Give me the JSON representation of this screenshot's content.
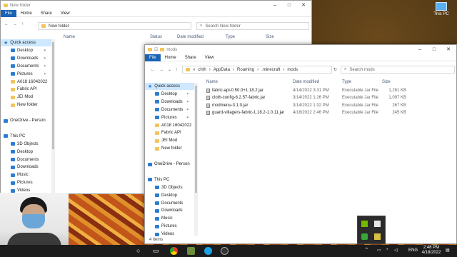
{
  "desktop": {
    "this_pc_label": "This PC"
  },
  "bg_window": {
    "title": "New folder",
    "tabs": [
      "File",
      "Home",
      "Share",
      "View"
    ],
    "path": "New folder",
    "search_placeholder": "Search New folder",
    "columns": [
      "Name",
      "Status",
      "Date modified",
      "Type",
      "Size"
    ],
    "sidebar": [
      {
        "label": "Quick access",
        "icon": "star",
        "sel": true
      },
      {
        "label": "Desktop",
        "icon": "blue",
        "pin": true
      },
      {
        "label": "Downloads",
        "icon": "blue",
        "pin": true
      },
      {
        "label": "Documents",
        "icon": "blue",
        "pin": true
      },
      {
        "label": "Pictures",
        "icon": "blue",
        "pin": true
      },
      {
        "label": "A018 16042022",
        "icon": "fold"
      },
      {
        "label": "Fabric API",
        "icon": "fold"
      },
      {
        "label": "JEI Mod",
        "icon": "fold"
      },
      {
        "label": "New folder",
        "icon": "fold"
      },
      {
        "label": "",
        "icon": ""
      },
      {
        "label": "OneDrive - Person",
        "icon": "blue"
      },
      {
        "label": "",
        "icon": ""
      },
      {
        "label": "This PC",
        "icon": "blue"
      },
      {
        "label": "3D Objects",
        "icon": "blue"
      },
      {
        "label": "Desktop",
        "icon": "blue"
      },
      {
        "label": "Documents",
        "icon": "blue"
      },
      {
        "label": "Downloads",
        "icon": "blue"
      },
      {
        "label": "Music",
        "icon": "blue"
      },
      {
        "label": "Pictures",
        "icon": "blue"
      },
      {
        "label": "Videos",
        "icon": "blue"
      }
    ]
  },
  "fg_window": {
    "title": "mods",
    "tabs": [
      "File",
      "Home",
      "Share",
      "View"
    ],
    "path": [
      "chth",
      "AppData",
      "Roaming",
      ".minecraft",
      "mods"
    ],
    "search_placeholder": "Search mods",
    "columns": [
      "Name",
      "Date modified",
      "Type",
      "Size"
    ],
    "files": [
      {
        "name": "fabric-api-0.50.0+1.18.2.jar",
        "date": "4/14/2022 3:31 PM",
        "type": "Executable Jar File",
        "size": "1,281 KB"
      },
      {
        "name": "cloth-config-6.2.57-fabric.jar",
        "date": "3/14/2022 1:26 PM",
        "type": "Executable Jar File",
        "size": "1,097 KB"
      },
      {
        "name": "modmenu-3.1.0.jar",
        "date": "3/14/2022 1:32 PM",
        "type": "Executable Jar File",
        "size": "267 KB"
      },
      {
        "name": "guard-villagers-fabric-1.18.2-1.0.11.jar",
        "date": "4/18/2022 2:46 PM",
        "type": "Executable Jar File",
        "size": "245 KB"
      }
    ],
    "sidebar": [
      {
        "label": "Quick access",
        "icon": "star",
        "sel": true
      },
      {
        "label": "Desktop",
        "icon": "blue",
        "pin": true
      },
      {
        "label": "Downloads",
        "icon": "blue",
        "pin": true
      },
      {
        "label": "Documents",
        "icon": "blue",
        "pin": true
      },
      {
        "label": "Pictures",
        "icon": "blue",
        "pin": true
      },
      {
        "label": "A018 16042022",
        "icon": "fold"
      },
      {
        "label": "Fabric API",
        "icon": "fold"
      },
      {
        "label": "JEI Mod",
        "icon": "fold"
      },
      {
        "label": "New folder",
        "icon": "fold"
      },
      {
        "label": "",
        "icon": ""
      },
      {
        "label": "OneDrive - Person",
        "icon": "blue"
      },
      {
        "label": "",
        "icon": ""
      },
      {
        "label": "This PC",
        "icon": "blue"
      },
      {
        "label": "3D Objects",
        "icon": "blue"
      },
      {
        "label": "Desktop",
        "icon": "blue"
      },
      {
        "label": "Documents",
        "icon": "blue"
      },
      {
        "label": "Downloads",
        "icon": "blue"
      },
      {
        "label": "Music",
        "icon": "blue"
      },
      {
        "label": "Pictures",
        "icon": "blue"
      },
      {
        "label": "Videos",
        "icon": "blue"
      }
    ],
    "status": "4 items"
  },
  "taskbar": {
    "time": "2:48 PM",
    "date": "4/18/2022",
    "lang": "ENG"
  }
}
